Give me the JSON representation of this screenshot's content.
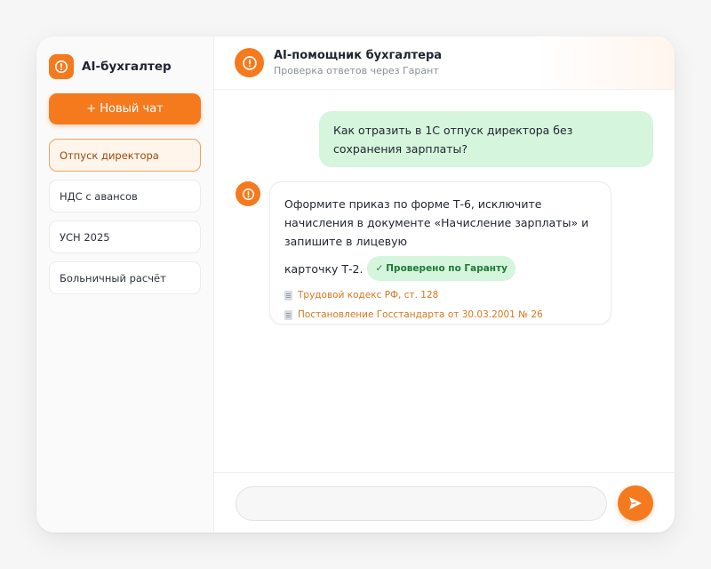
{
  "sidebar": {
    "brand_title": "AI-бухгалтер",
    "new_chat_label": "+ Новый чат",
    "chats": [
      {
        "label": "Отпуск директора",
        "active": true
      },
      {
        "label": "НДС с авансов",
        "active": false
      },
      {
        "label": "УСН 2025",
        "active": false
      },
      {
        "label": "Больничный расчёт",
        "active": false
      }
    ]
  },
  "header": {
    "title": "AI-помощник бухгалтера",
    "subtitle": "Проверка ответов через Гарант"
  },
  "messages": {
    "user_text": "Как отразить в 1С отпуск директора без сохранения зарплаты?",
    "bot_text": "Оформите приказ по форме Т-6, исключите начисления в документе «Начисление зарплаты» и запишите в лицевую",
    "bot_text_end": "карточку Т-2.",
    "verified_check": "✓",
    "verified_label": "Проверено по Гаранту",
    "sources": [
      "Трудовой кодекс РФ, ст. 128",
      "Постановление Госстандарта от 30.03.2001 № 26"
    ]
  },
  "composer": {
    "placeholder": ""
  },
  "colors": {
    "accent": "#f57a1e",
    "user_bubble": "#d6f5dd",
    "verified_text": "#1f7a35",
    "active_chat_bg": "#fff5ea",
    "source_link": "#d9761f"
  },
  "icons": {
    "brand": "alert-circle-icon",
    "header_avatar": "alert-circle-icon",
    "bot_avatar": "alert-circle-icon",
    "source": "document-icon",
    "send": "send-icon"
  }
}
